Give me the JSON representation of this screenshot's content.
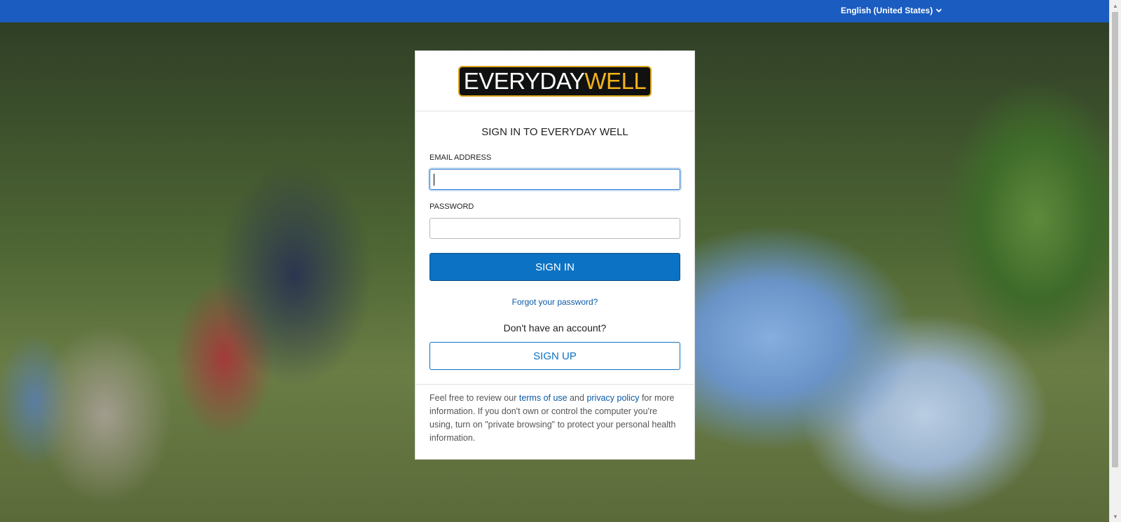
{
  "topbar": {
    "language": "English (United States)",
    "color": "#1a5cc0"
  },
  "logo": {
    "part1": "EVERYDAY",
    "part2": "WELL"
  },
  "form": {
    "title": "SIGN IN TO EVERYDAY WELL",
    "email_label": "EMAIL ADDRESS",
    "email_value": "",
    "password_label": "PASSWORD",
    "password_value": "",
    "signin_label": "SIGN IN",
    "forgot_label": "Forgot your password?",
    "no_account_text": "Don't have an account?",
    "signup_label": "SIGN UP",
    "accent_color": "#0c72c3"
  },
  "footnote": {
    "text_before": "Feel free to review our ",
    "terms_link": "terms of use",
    "text_and": " and ",
    "privacy_link": "privacy policy",
    "text_after": " for more information. If you don't own or control the computer you're using, turn on \"private browsing\" to protect your personal health information."
  },
  "icons": {
    "language_dropdown": "chevron-down-icon"
  }
}
